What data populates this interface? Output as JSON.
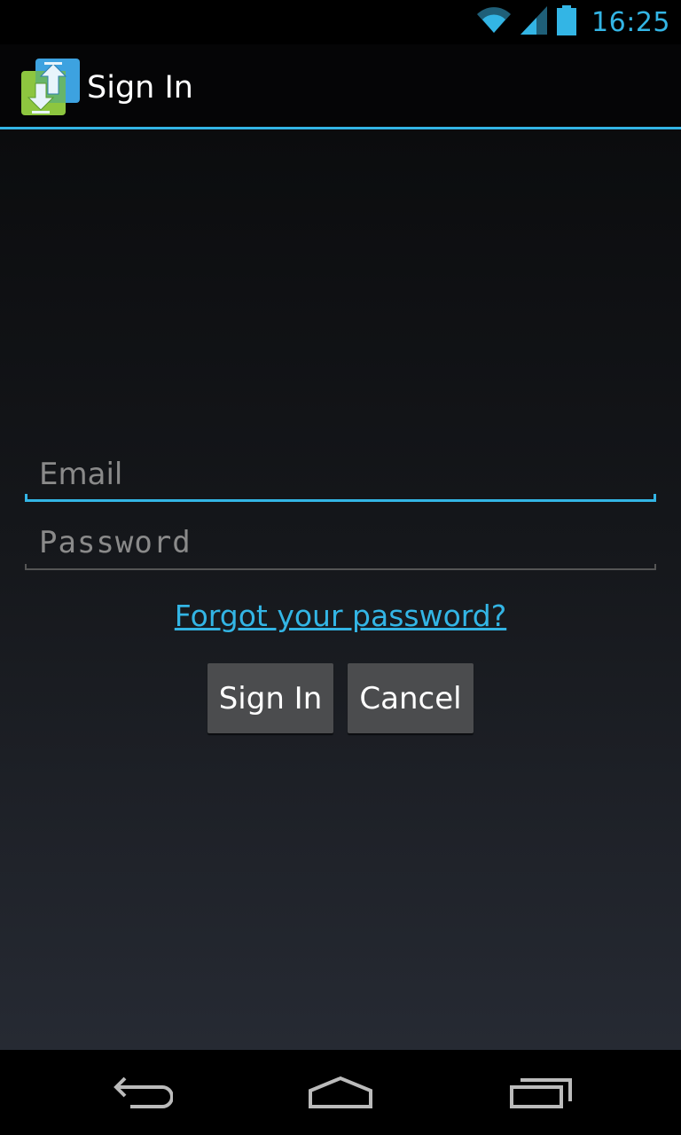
{
  "status_bar": {
    "time": "16:25",
    "accent_color": "#33b5e5",
    "icons": [
      "wifi-icon",
      "signal-icon",
      "battery-icon"
    ]
  },
  "action_bar": {
    "title": "Sign In",
    "app_icon": "sync-arrows-icon"
  },
  "form": {
    "email_placeholder": "Email",
    "email_value": "",
    "password_placeholder": "Password",
    "password_value": "",
    "forgot_link": "Forgot your password?",
    "sign_in_label": "Sign In",
    "cancel_label": "Cancel"
  },
  "nav_bar": {
    "icons": [
      "back-icon",
      "home-icon",
      "recent-apps-icon"
    ]
  }
}
